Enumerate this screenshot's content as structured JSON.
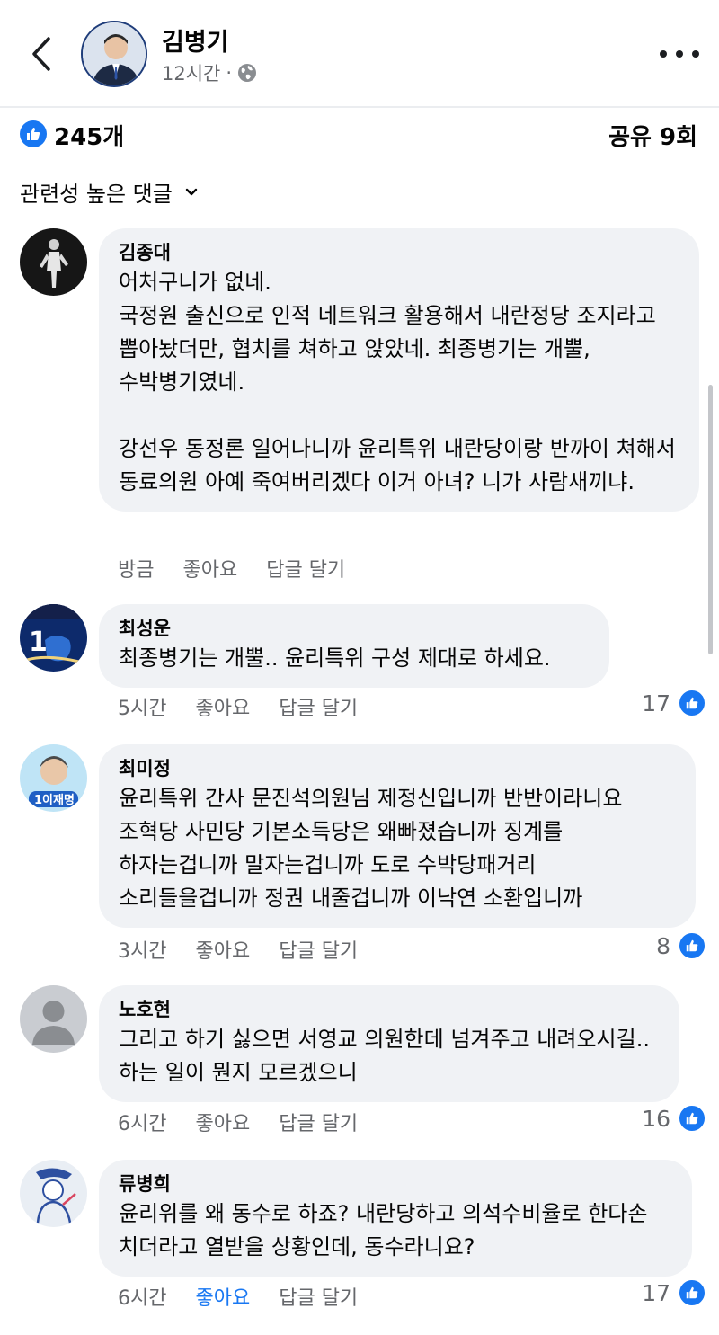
{
  "header": {
    "author_name": "김병기",
    "time": "12시간",
    "dot": "·",
    "icons": {
      "back": "chevron-left-icon",
      "audience": "globe-icon",
      "more": "more-horizontal-icon"
    }
  },
  "stats": {
    "likes": "245개",
    "shares": "공유 9회"
  },
  "sort": {
    "label": "관련성 높은 댓글",
    "icon": "chevron-down-icon"
  },
  "colors": {
    "accent": "#1877f2",
    "bubble": "#f0f2f5",
    "secondary_text": "#65676b"
  },
  "comments": [
    {
      "name": "김종대",
      "text": "어처구니가 없네.\n국정원 출신으로 인적 네트워크 활용해서 내란정당 조지라고 뽑아놨더만, 협치를 쳐하고 앉았네. 최종병기는 개뿔, 수박병기였네.\n\n강선우 동정론 일어나니까 윤리특위 내란당이랑 반까이 쳐해서 동료의원 아예 죽여버리겠다 이거 아녀? 니가 사람새끼냐.",
      "time": "방금",
      "like_label": "좋아요",
      "reply_label": "답글 달기",
      "reactions": ""
    },
    {
      "name": "최성운",
      "text": "최종병기는 개뿔.. 윤리특위 구성 제대로 하세요.",
      "time": "5시간",
      "like_label": "좋아요",
      "reply_label": "답글 달기",
      "reactions": "17"
    },
    {
      "name": "최미정",
      "text": "윤리특위 간사 문진석의원님 제정신입니까 반반이라니요 조혁당 사민당 기본소득당은 왜빠졌습니까 징계를 하자는겁니까 말자는겁니까 도로 수박당패거리 소리들을겁니까 정권 내줄겁니까 이낙연 소환입니까",
      "time": "3시간",
      "like_label": "좋아요",
      "reply_label": "답글 달기",
      "reactions": "8"
    },
    {
      "name": "노호현",
      "text": "그리고 하기 싫으면 서영교 의원한데 넘겨주고 내려오시길.. 하는 일이 뭔지 모르겠으니",
      "time": "6시간",
      "like_label": "좋아요",
      "reply_label": "답글 달기",
      "reactions": "16"
    },
    {
      "name": "류병희",
      "text": "윤리위를 왜 동수로 하죠? 내란당하고 의석수비율로 한다손 치더라고 열받을 상황인데, 동수라니요?",
      "time": "6시간",
      "like_label": "좋아요",
      "reply_label": "답글 달기",
      "reactions": "17"
    }
  ]
}
